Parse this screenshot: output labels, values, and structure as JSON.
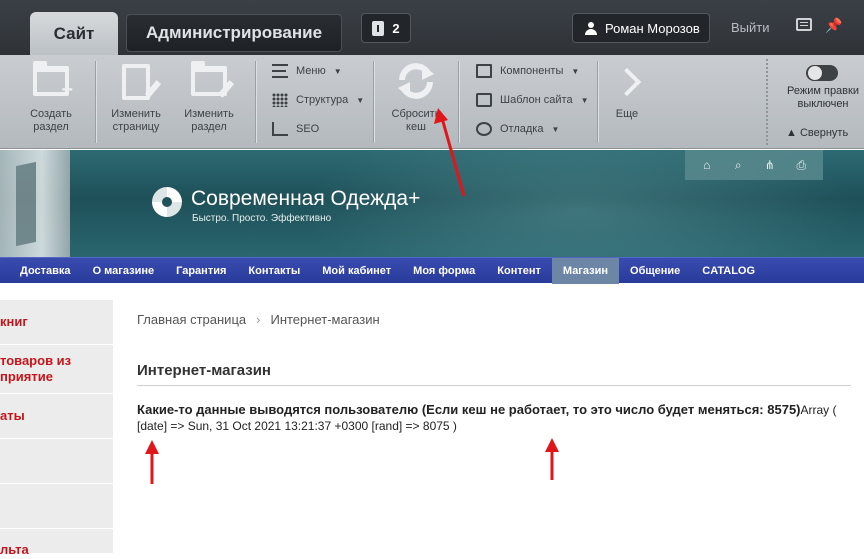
{
  "admin": {
    "tab_site": "Сайт",
    "tab_admin": "Администрирование",
    "notifications_count": "2",
    "user_name": "Роман Морозов",
    "logout": "Выйти"
  },
  "toolbar": {
    "create_section": "Создать\nраздел",
    "edit_page": "Изменить\nстраницу",
    "edit_section": "Изменить\nраздел",
    "menu": "Меню",
    "structure": "Структура",
    "seo": "SEO",
    "reset_cache": "Сбросить\nкеш",
    "components": "Компоненты",
    "site_template": "Шаблон сайта",
    "debug": "Отладка",
    "more": "Еще",
    "edit_mode": "Режим правки\nвыключен",
    "collapse": "Свернуть"
  },
  "header": {
    "logo_title": "Современная Одежда+",
    "logo_subtitle": "Быстро. Просто. Эффективно",
    "icons": [
      "home-icon",
      "search-icon",
      "sitemap-icon",
      "print-icon"
    ]
  },
  "nav": {
    "items": [
      "Доставка",
      "О магазине",
      "Гарантия",
      "Контакты",
      "Мой кабинет",
      "Моя форма",
      "Контент",
      "Магазин",
      "Общение",
      "CATALOG"
    ],
    "active_index": 7
  },
  "sidebar": {
    "items": [
      "книг",
      "товаров из\nприятие",
      "аты",
      "",
      "",
      "",
      "льта"
    ]
  },
  "main": {
    "breadcrumb_home": "Главная страница",
    "breadcrumb_sep": "›",
    "breadcrumb_current": "Интернет-магазин",
    "title": "Интернет-магазин",
    "bold_text": "Какие-то данные выводятся пользователю (Если кеш не работает, то это число будет меняться:",
    "bold_number": "8575)",
    "array_text": "Array ( [date] => Sun, 31 Oct 2021 13:21:37 +0300 [rand] => 8075 )"
  },
  "colors": {
    "accent_red": "#e0161b",
    "nav_blue": "#2f40a3",
    "header_teal": "#245a62"
  }
}
